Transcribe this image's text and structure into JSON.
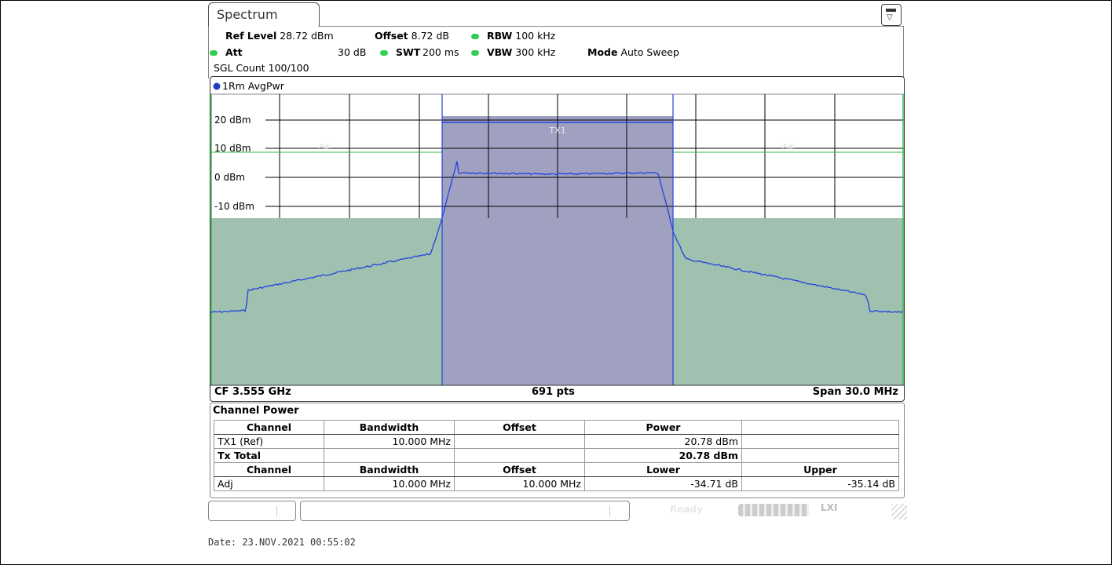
{
  "app": {
    "tab_title": "Spectrum"
  },
  "settings": {
    "ref_level_label": "Ref Level",
    "ref_level_value": "28.72 dBm",
    "offset_label": "Offset",
    "offset_value": "8.72 dB",
    "rbw_label": "RBW",
    "rbw_value": "100 kHz",
    "att_label": "Att",
    "att_value": "30 dB",
    "swt_label": "SWT",
    "swt_value": "200 ms",
    "vbw_label": "VBW",
    "vbw_value": "300 kHz",
    "mode_label": "Mode",
    "mode_value": "Auto Sweep",
    "sgl_count": "SGL Count 100/100",
    "status_dot_color": "#33cc55"
  },
  "diagram": {
    "trace_label": "1Rm AvgPwr",
    "trace_dot_color": "#2040c0",
    "y_labels": [
      "20 dBm",
      "10 dBm",
      "0 dBm",
      "-10 dBm"
    ],
    "channel_label": "TX1",
    "adj_label": "Adj",
    "footer": {
      "center_freq": "CF 3.555 GHz",
      "points": "691 pts",
      "span": "Span 30.0 MHz"
    },
    "colors": {
      "trace": "#2244dd",
      "channel_fill": "#a0a0c0",
      "adj_fill": "#a0c0b0",
      "limit_line": "#33bb44"
    }
  },
  "table": {
    "title": "Channel Power",
    "header1": [
      "Channel",
      "Bandwidth",
      "Offset",
      "Power",
      ""
    ],
    "rows1": [
      [
        "TX1 (Ref)",
        "10.000 MHz",
        "",
        "20.78 dBm",
        ""
      ],
      [
        "Tx Total",
        "",
        "",
        "20.78 dBm",
        ""
      ]
    ],
    "header2": [
      "Channel",
      "Bandwidth",
      "Offset",
      "Lower",
      "Upper"
    ],
    "rows2": [
      [
        "Adj",
        "10.000 MHz",
        "10.000 MHz",
        "-34.71 dB",
        "-35.14 dB"
      ]
    ]
  },
  "status": {
    "ready": "Ready",
    "lxi": "LXI"
  },
  "footer_date": "Date: 23.NOV.2021  00:55:02"
}
